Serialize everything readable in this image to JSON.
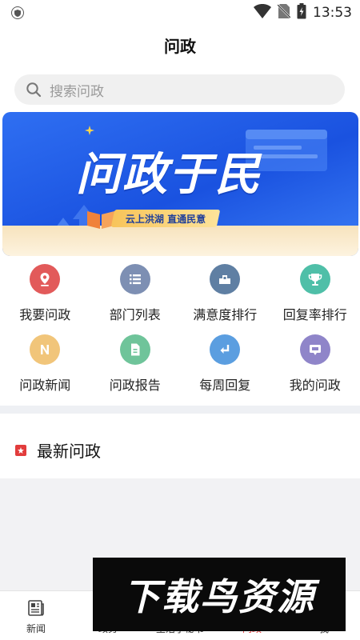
{
  "status_bar": {
    "time": "13:53",
    "icons": [
      "shield-icon",
      "wifi-icon",
      "no-sim-icon",
      "battery-icon"
    ]
  },
  "header": {
    "title": "问政"
  },
  "search": {
    "placeholder": "搜索问政"
  },
  "banner": {
    "title": "问政于民",
    "tagline": "云上洪湖 直通民意"
  },
  "grid": {
    "items": [
      {
        "label": "我要问政",
        "icon": "location-pin-icon",
        "color": "#e25a5a"
      },
      {
        "label": "部门列表",
        "icon": "list-icon",
        "color": "#7d8fb3"
      },
      {
        "label": "满意度排行",
        "icon": "chart-icon",
        "color": "#5f7fa3"
      },
      {
        "label": "回复率排行",
        "icon": "trophy-icon",
        "color": "#4fbfa8"
      },
      {
        "label": "问政新闻",
        "icon": "news-icon",
        "color": "#f1c57a"
      },
      {
        "label": "问政报告",
        "icon": "document-icon",
        "color": "#6fc49a"
      },
      {
        "label": "每周回复",
        "icon": "reply-icon",
        "color": "#5b9ee0"
      },
      {
        "label": "我的问政",
        "icon": "message-icon",
        "color": "#8f85c9"
      }
    ]
  },
  "section": {
    "title": "最新问政",
    "icon": "bookmark-icon",
    "accent": "#e23c3c"
  },
  "bottom_nav": {
    "items": [
      {
        "label": "新闻",
        "icon": "newspaper-icon",
        "active": false
      },
      {
        "label": "政务",
        "icon": "government-icon",
        "active": false
      },
      {
        "label": "生活小秘书",
        "icon": "assistant-icon",
        "active": false
      },
      {
        "label": "问政",
        "icon": "ask-icon",
        "active": true
      },
      {
        "label": "我",
        "icon": "user-icon",
        "active": false
      }
    ]
  },
  "watermark": {
    "text": "下载鸟资源"
  }
}
